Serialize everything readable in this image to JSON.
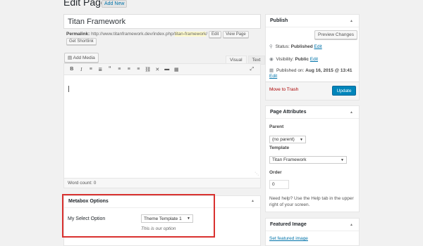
{
  "header": {
    "title": "Edit Page",
    "add_new": "Add New"
  },
  "post": {
    "title": "Titan Framework",
    "permalink_label": "Permalink:",
    "permalink_base": "http://www.titanframework.dev/index.php/",
    "permalink_slug": "titan-framework",
    "permalink_trail": "/",
    "edit_btn": "Edit",
    "view_btn": "View Page",
    "shortlink_btn": "Get Shortlink"
  },
  "editor": {
    "add_media": "Add Media",
    "tab_visual": "Visual",
    "tab_text": "Text",
    "toolbar": [
      "B",
      "I",
      "≡",
      "≣",
      "“",
      "≡",
      "≡",
      "≡",
      "⛓",
      "✕",
      "▬",
      "▦"
    ],
    "fullscreen": "⤢",
    "word_count": "Word count: 0"
  },
  "metabox": {
    "title": "Metabox Options",
    "option_label": "My Select Option",
    "option_value": "Theme Template 1",
    "option_desc": "This is our option"
  },
  "publish": {
    "title": "Publish",
    "preview": "Preview Changes",
    "status_label": "Status:",
    "status_value": "Published",
    "status_edit": "Edit",
    "visibility_label": "Visibility:",
    "visibility_value": "Public",
    "visibility_edit": "Edit",
    "published_label": "Published on:",
    "published_value": "Aug 16, 2015 @ 13:41",
    "published_edit": "Edit",
    "trash": "Move to Trash",
    "update": "Update"
  },
  "attributes": {
    "title": "Page Attributes",
    "parent_label": "Parent",
    "parent_value": "(no parent)",
    "template_label": "Template",
    "template_value": "Titan Framework",
    "order_label": "Order",
    "order_value": "0",
    "help": "Need help? Use the Help tab in the upper right of your screen."
  },
  "featured": {
    "title": "Featured Image",
    "link": "Set featured image"
  },
  "colors": {
    "accent": "#0085ba",
    "link": "#0073aa",
    "highlight": "#d9312f",
    "trash": "#aa0000"
  }
}
